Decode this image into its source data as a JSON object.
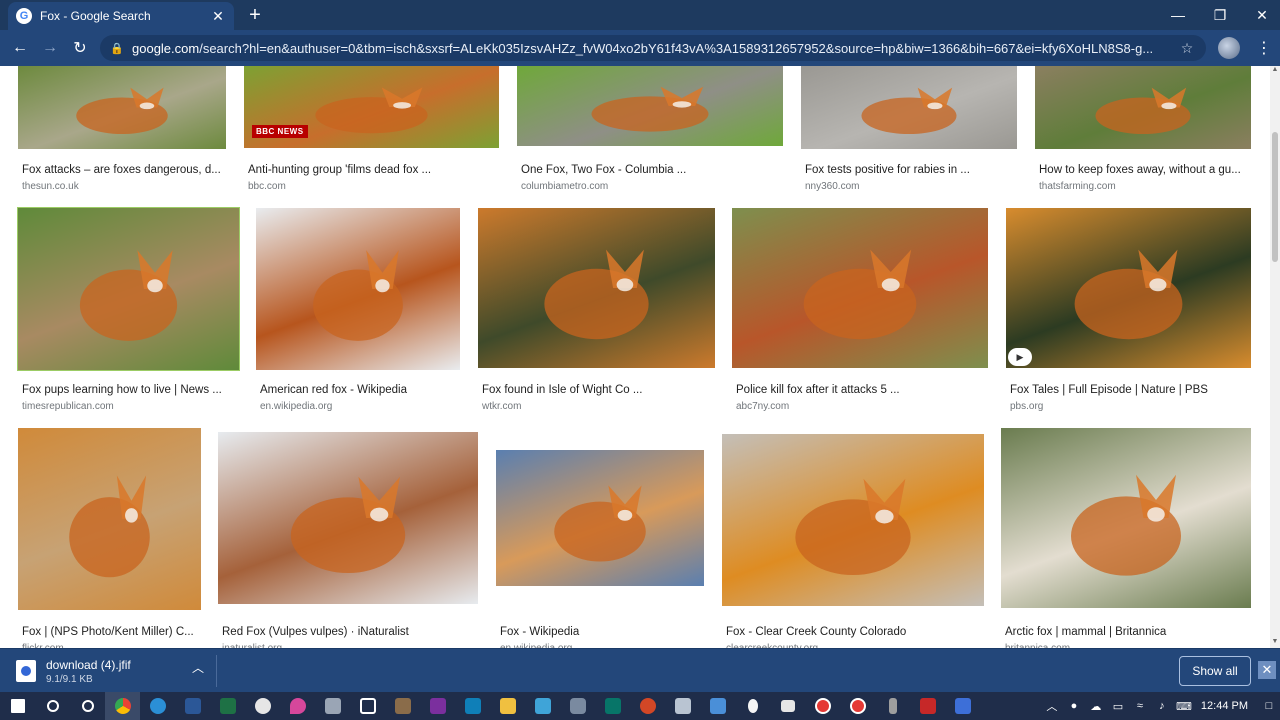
{
  "browser": {
    "tab_title": "Fox - Google Search",
    "tab_close": "✕",
    "new_tab": "+",
    "url_host": "google.com",
    "url_rest": "/search?hl=en&authuser=0&tbm=isch&sxsrf=ALeKk035IzsvAHZz_fvW04xo2bY61f43vA%3A1589312657952&source=hp&biw=1366&bih=667&ei=kfy6XoHLN8S8-g...",
    "window_controls": {
      "minimize": "—",
      "maximize": "❐",
      "close": "✕"
    }
  },
  "results": [
    {
      "caption": "Fox attacks – are foxes dangerous, d...",
      "domain": "thesun.co.uk",
      "colors": [
        "#6d8a3e",
        "#a9a78a"
      ]
    },
    {
      "caption": "Anti-hunting group 'films dead fox ...",
      "domain": "bbc.com",
      "badge": "BBC NEWS",
      "colors": [
        "#7da133",
        "#c76e2c"
      ]
    },
    {
      "caption": "One Fox, Two Fox - Columbia ...",
      "domain": "columbiametro.com",
      "colors": [
        "#6fa83a",
        "#8f8f86"
      ]
    },
    {
      "caption": "Fox tests positive for rabies in ...",
      "domain": "nny360.com",
      "colors": [
        "#9a9893",
        "#b7b5b1"
      ]
    },
    {
      "caption": "How to keep foxes away, without a gu...",
      "domain": "thatsfarming.com",
      "colors": [
        "#8b7f60",
        "#5f7d3a"
      ]
    },
    {
      "caption": "Fox pups learning how to live | News ...",
      "domain": "timesrepublican.com",
      "colors": [
        "#5f8a3a",
        "#a88a62"
      ]
    },
    {
      "caption": "American red fox - Wikipedia",
      "domain": "en.wikipedia.org",
      "colors": [
        "#e9ecef",
        "#b7551d"
      ]
    },
    {
      "caption": "Fox found in Isle of Wight Co ...",
      "domain": "wtkr.com",
      "colors": [
        "#cc7a2c",
        "#3f4a2a"
      ]
    },
    {
      "caption": "Police kill fox after it attacks 5 ...",
      "domain": "abc7ny.com",
      "colors": [
        "#7e8f4e",
        "#b8562a"
      ]
    },
    {
      "caption": "Fox Tales | Full Episode | Nature | PBS",
      "domain": "pbs.org",
      "play": "▶",
      "colors": [
        "#d88c2e",
        "#2c3b22"
      ]
    },
    {
      "caption": "Fox | (NPS Photo/Kent Miller) C...",
      "domain": "flickr.com",
      "colors": [
        "#d08a3a",
        "#c7a274"
      ]
    },
    {
      "caption": "Red Fox (Vulpes vulpes) · iNaturalist",
      "domain": "inaturalist.org",
      "colors": [
        "#e7ebef",
        "#a5613a"
      ]
    },
    {
      "caption": "Fox - Wikipedia",
      "domain": "en.wikipedia.org",
      "colors": [
        "#5a7fb0",
        "#d89a5a"
      ]
    },
    {
      "caption": "Fox - Clear Creek County Colorado",
      "domain": "clearcreekcounty.org",
      "colors": [
        "#c4bfb8",
        "#de8c22"
      ]
    },
    {
      "caption": "Arctic fox | mammal | Britannica",
      "domain": "britannica.com",
      "colors": [
        "#6a7c4f",
        "#e3ddd0"
      ]
    }
  ],
  "download": {
    "filename": "download (4).jfif",
    "size": "9.1/9.1 KB",
    "chevron": "︿",
    "show_all": "Show all",
    "close": "✕"
  },
  "taskbar": {
    "time": "12:44 PM"
  }
}
